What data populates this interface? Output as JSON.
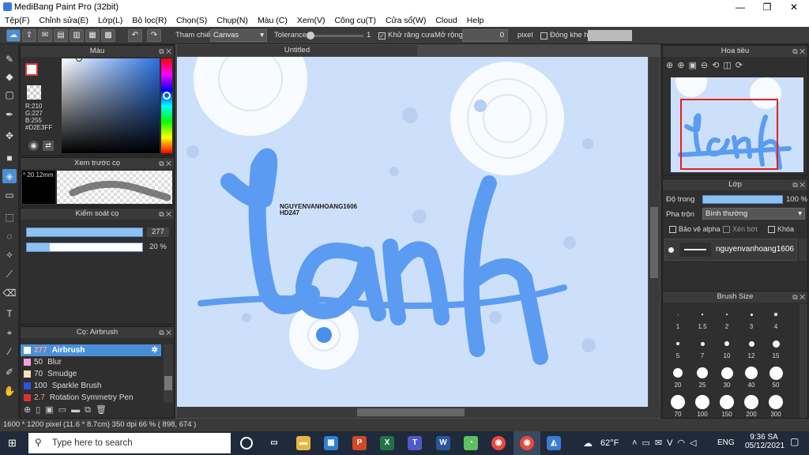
{
  "titlebar": {
    "title": "MediBang Paint Pro (32bit)",
    "minimize": "—",
    "maximize": "❐",
    "close": "✕"
  },
  "menu": [
    "Tệp(F)",
    "Chỉnh sửa(E)",
    "Lớp(L)",
    "Bộ lọc(R)",
    "Chọn(S)",
    "Chụp(N)",
    "Màu (C)",
    "Xem(V)",
    "Công cụ(T)",
    "Cửa sổ(W)",
    "Cloud",
    "Help"
  ],
  "toolbar": {
    "reference_label": "Tham chiếu",
    "reference_value": "Canvas",
    "tolerance_label": "Tolerance",
    "tolerance_value": "1",
    "antialias_label": "Khử răng cưa",
    "expand_label": "Mở rộng",
    "expand_value": "0",
    "expand_unit": "pixel",
    "close_gap_label": "Đóng khe hở"
  },
  "color_panel": {
    "title": "Màu",
    "r": "R:210",
    "g": "G:227",
    "b": "B:255",
    "hex": "#D2E3FF"
  },
  "brush_preview": {
    "title": "Xem trước cọ",
    "size": "* 20.12mm"
  },
  "brush_control": {
    "title": "Kiểm soát cọ",
    "size_value": "277",
    "opacity_value": "20 %",
    "opacity_fraction": 0.2
  },
  "brush_list": {
    "title": "Cọ: Airbrush",
    "items": [
      {
        "size": "277",
        "name": "Airbrush",
        "color": "#ffffff"
      },
      {
        "size": "50",
        "name": "Blur",
        "color": "#f0a0e0"
      },
      {
        "size": "70",
        "name": "Smudge",
        "color": "#f5e0c0"
      },
      {
        "size": "100",
        "name": "Sparkle Brush",
        "color": "#3050e0"
      },
      {
        "size": "2.7",
        "name": "Rotation Symmetry Pen",
        "color": "#e03030"
      }
    ]
  },
  "canvas": {
    "tab": "Untitled",
    "watermark_line1": "NGUYENVANHOANG1606",
    "watermark_line2": "HD247",
    "art_text": "Lanh"
  },
  "navigator": {
    "title": "Hoa tiêu"
  },
  "layers": {
    "title": "Lớp",
    "opacity_label": "Độ trong",
    "opacity_value": "100 %",
    "blend_label": "Pha trộn",
    "blend_value": "Bình thường",
    "protect_alpha": "Bảo vệ alpha",
    "clipping": "Xén bớt",
    "lock": "Khóa",
    "layer_name": "nguyenvanhoang1606"
  },
  "brush_size": {
    "title": "Brush Size",
    "sizes": [
      "1",
      "1.5",
      "2",
      "3",
      "4",
      "5",
      "7",
      "10",
      "12",
      "15",
      "20",
      "25",
      "30",
      "40",
      "50",
      "70",
      "100",
      "150",
      "200",
      "300"
    ]
  },
  "status": "1600 * 1200 pixel  (11.6 * 8.7cm)  350 dpi  66 %  ( 898, 674 )",
  "taskbar": {
    "search_placeholder": "Type here to search",
    "weather": "62°F",
    "lang": "ENG",
    "time": "9:36 SA",
    "date": "05/12/2021"
  }
}
